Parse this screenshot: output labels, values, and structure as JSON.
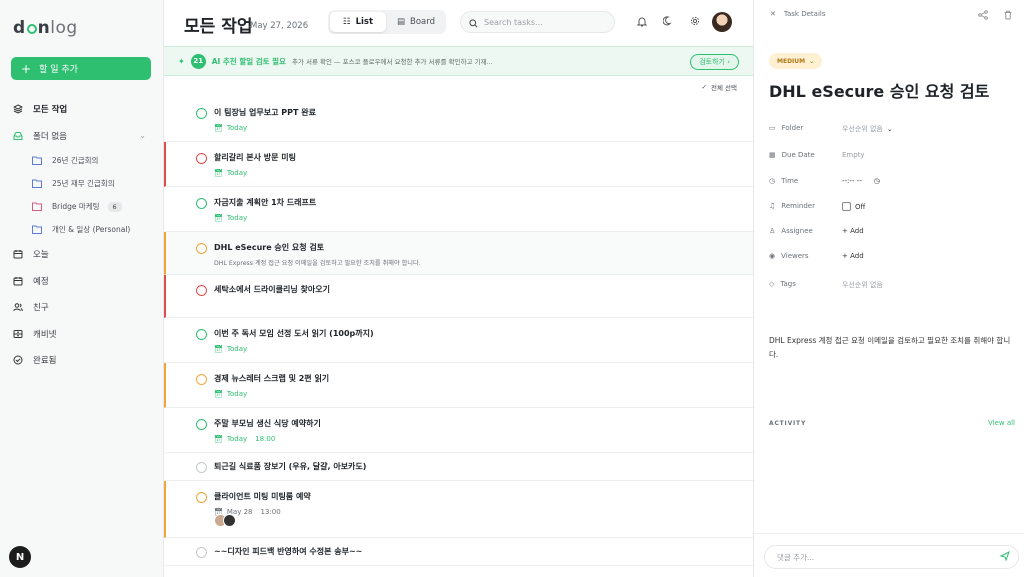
{
  "app": {
    "logo_prefix": "d",
    "logo_mid": "n",
    "logo_rest": "log"
  },
  "sidebar": {
    "add_label": "할 일 추가",
    "items": [
      {
        "label": "모든 작업",
        "icon": "layers-icon"
      },
      {
        "label": "폴더 없음",
        "icon": "inbox-icon"
      },
      {
        "label": "26년 긴급회의",
        "icon": "folder-icon"
      },
      {
        "label": "25년 재무 긴급회의",
        "icon": "folder-icon"
      },
      {
        "label": "Bridge 마케팅",
        "icon": "folder-icon",
        "badge": "6"
      },
      {
        "label": "개인 & 일상 (Personal)",
        "icon": "folder-icon"
      },
      {
        "label": "오늘",
        "icon": "calendar-icon"
      },
      {
        "label": "예정",
        "icon": "calendar-icon"
      },
      {
        "label": "친구",
        "icon": "users-icon"
      },
      {
        "label": "캐비넷",
        "icon": "cabinet-icon"
      },
      {
        "label": "완료됨",
        "icon": "check-circle-icon"
      }
    ],
    "user_initial": "N"
  },
  "header": {
    "title": "모든 작업",
    "date": "May 27, 2026",
    "list_label": "List",
    "board_label": "Board",
    "search_placeholder": "Search tasks..."
  },
  "banner": {
    "count": "21",
    "title": "AI 추천 할일 검토 필요",
    "desc": "추가 서류 확인 — 포스코 플로우에서 요청한 추가 서류를 확인하고 기재...",
    "button": "검토하기"
  },
  "select_all": "전체 선택",
  "tasks": [
    {
      "title": "이 팀장님 업무보고 PPT 완료",
      "date": "Today",
      "time": "",
      "desc": "",
      "color": "green",
      "bar": ""
    },
    {
      "title": "할리갈리 본사 방문 미팅",
      "date": "Today",
      "time": "",
      "desc": "",
      "color": "red",
      "bar": "red"
    },
    {
      "title": "자금지출 계획안 1차 드래프트",
      "date": "Today",
      "time": "",
      "desc": "",
      "color": "green",
      "bar": ""
    },
    {
      "title": "DHL eSecure 승인 요청 검토",
      "date": "",
      "time": "",
      "desc": "DHL Express 계정 접근 요청 이메일을 검토하고 필요한 조치를 취해야 합니다.",
      "color": "orange",
      "bar": "orange"
    },
    {
      "title": "세탁소에서 드라이클리닝 찾아오기",
      "date": "",
      "time": "",
      "desc": "",
      "color": "red",
      "bar": "red"
    },
    {
      "title": "이번 주 독서 모임 선정 도서 읽기 (100p까지)",
      "date": "Today",
      "time": "",
      "desc": "",
      "color": "green",
      "bar": ""
    },
    {
      "title": "경제 뉴스레터 스크랩 및 2편 읽기",
      "date": "Today",
      "time": "",
      "desc": "",
      "color": "orange",
      "bar": "orange"
    },
    {
      "title": "주말 부모님 생신 식당 예약하기",
      "date": "Today",
      "time": "18:00",
      "desc": "",
      "color": "green",
      "bar": ""
    },
    {
      "title": "퇴근길 식료품 장보기 (우유, 달걀, 아보카도)",
      "date": "",
      "time": "",
      "desc": "",
      "color": "gray",
      "bar": ""
    },
    {
      "title": "클라이언트 미팅 미팅룸 예약",
      "date": "May 28",
      "time": "13:00",
      "desc": "",
      "color": "orange",
      "bar": "orange"
    },
    {
      "title": "~~디자인 피드백 반영하여 수정본 송부~~",
      "date": "",
      "time": "",
      "desc": "",
      "color": "gray",
      "bar": ""
    }
  ],
  "panel": {
    "header": "Task Details",
    "priority": "MEDIUM",
    "title": "DHL eSecure 승인 요청 검토",
    "props": {
      "folder_label": "Folder",
      "folder_value": "우선순위 없음",
      "due_label": "Due Date",
      "due_value": "Empty",
      "time_label": "Time",
      "time_value": "--:-- --",
      "reminder_label": "Reminder",
      "reminder_value": "Off",
      "assignee_label": "Assignee",
      "assignee_value": "+ Add",
      "viewers_label": "Viewers",
      "viewers_value": "+ Add",
      "tags_label": "Tags",
      "tags_value": "우선순위 없음"
    },
    "description": "DHL Express 계정 접근 요청 이메일을 검토하고 필요한 조치를 취해야 합니다.",
    "activity_label": "ACTIVITY",
    "view_all": "View all",
    "comment_placeholder": "댓글 추가..."
  },
  "colors": {
    "accent": "#2fbf71",
    "red": "#e04c4c",
    "orange": "#f0a53a"
  }
}
